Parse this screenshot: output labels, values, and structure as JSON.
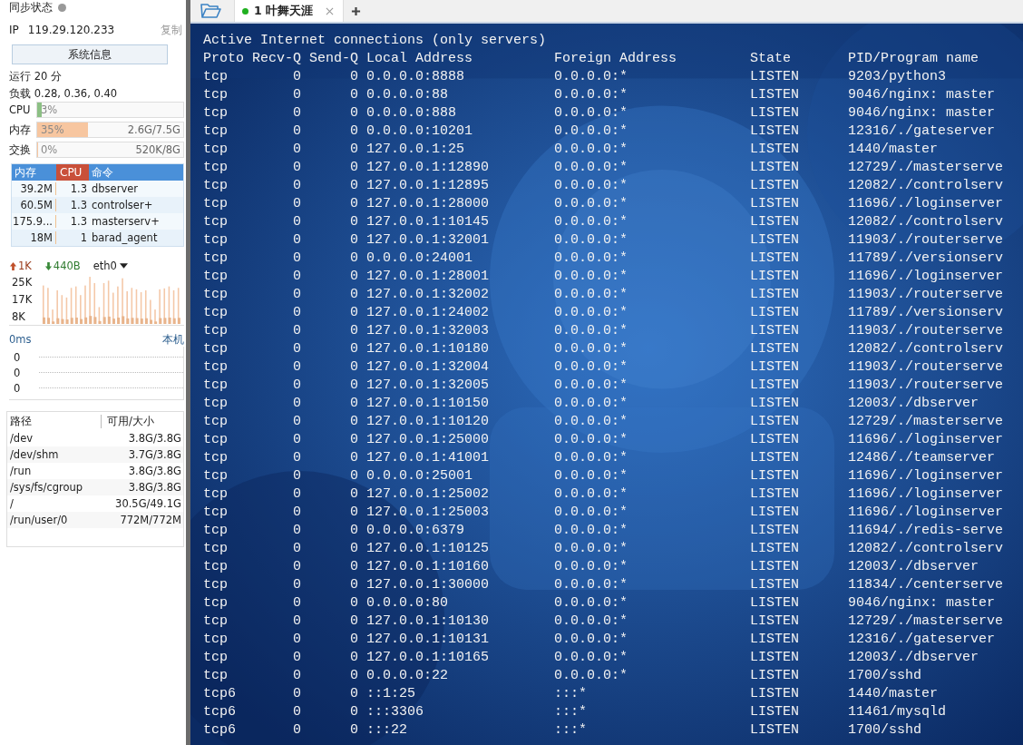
{
  "sidebar": {
    "sync_label": "同步状态",
    "sync_online": false,
    "ip_label": "IP",
    "ip": "119.29.120.233",
    "copy_link": "复制",
    "sysinfo_button": "系统信息",
    "uptime": "运行 20 分",
    "load": "负载 0.28, 0.36, 0.40",
    "meters": [
      {
        "label": "CPU",
        "value": "3%",
        "level": 0.03,
        "color": "#8cc084"
      },
      {
        "label": "内存",
        "value": "35%",
        "level": 0.35,
        "reading": "2.6G/7.5G",
        "color": "#f7c6a0"
      },
      {
        "label": "交换",
        "value": "0%",
        "level": 0,
        "reading": "520K/8G",
        "color": "#f7c6a0"
      }
    ],
    "processes": {
      "columns": [
        {
          "label": "内存",
          "selected": false
        },
        {
          "label": "CPU",
          "selected": true
        },
        {
          "label": "命令",
          "selected": false
        }
      ],
      "rows": [
        [
          "39.2M",
          "1.3",
          "dbserver"
        ],
        [
          "60.5M",
          "1.3",
          "controlser+"
        ],
        [
          "175.9...",
          "1.3",
          "masterserv+"
        ],
        [
          "18M",
          "1",
          "barad_agent"
        ]
      ]
    },
    "network": {
      "up": "1K",
      "down": "440B",
      "interface": "eth0",
      "yticks": [
        "25K",
        "17K",
        "8K"
      ]
    },
    "ping": {
      "latency": "0ms",
      "host": "本机",
      "values": [
        "0",
        "0",
        "0"
      ]
    },
    "disks": {
      "columns": [
        "路径",
        "可用/大小"
      ],
      "rows": [
        {
          "path": "/dev",
          "usage": "3.8G/3.8G"
        },
        {
          "path": "/dev/shm",
          "usage": "3.7G/3.8G"
        },
        {
          "path": "/run",
          "usage": "3.8G/3.8G"
        },
        {
          "path": "/sys/fs/cgroup",
          "usage": "3.8G/3.8G"
        },
        {
          "path": "/",
          "usage": "30.5G/49.1G"
        },
        {
          "path": "/run/user/0",
          "usage": "772M/772M"
        }
      ]
    }
  },
  "tabs": [
    {
      "label": "1 叶舞天涯",
      "selected": true,
      "connected": true
    }
  ],
  "terminal": {
    "title_line": "Active Internet connections (only servers)",
    "columns": [
      "Proto",
      "Recv-Q",
      "Send-Q",
      "Local Address",
      "Foreign Address",
      "State",
      "PID/Program name"
    ],
    "rows": [
      [
        "tcp",
        "0",
        "0",
        "0.0.0.0:8888",
        "0.0.0.0:*",
        "LISTEN",
        "9203/python3"
      ],
      [
        "tcp",
        "0",
        "0",
        "0.0.0.0:88",
        "0.0.0.0:*",
        "LISTEN",
        "9046/nginx: master"
      ],
      [
        "tcp",
        "0",
        "0",
        "0.0.0.0:888",
        "0.0.0.0:*",
        "LISTEN",
        "9046/nginx: master"
      ],
      [
        "tcp",
        "0",
        "0",
        "0.0.0.0:10201",
        "0.0.0.0:*",
        "LISTEN",
        "12316/./gateserver"
      ],
      [
        "tcp",
        "0",
        "0",
        "127.0.0.1:25",
        "0.0.0.0:*",
        "LISTEN",
        "1440/master"
      ],
      [
        "tcp",
        "0",
        "0",
        "127.0.0.1:12890",
        "0.0.0.0:*",
        "LISTEN",
        "12729/./masterserve"
      ],
      [
        "tcp",
        "0",
        "0",
        "127.0.0.1:12895",
        "0.0.0.0:*",
        "LISTEN",
        "12082/./controlserv"
      ],
      [
        "tcp",
        "0",
        "0",
        "127.0.0.1:28000",
        "0.0.0.0:*",
        "LISTEN",
        "11696/./loginserver"
      ],
      [
        "tcp",
        "0",
        "0",
        "127.0.0.1:10145",
        "0.0.0.0:*",
        "LISTEN",
        "12082/./controlserv"
      ],
      [
        "tcp",
        "0",
        "0",
        "127.0.0.1:32001",
        "0.0.0.0:*",
        "LISTEN",
        "11903/./routerserve"
      ],
      [
        "tcp",
        "0",
        "0",
        "0.0.0.0:24001",
        "0.0.0.0:*",
        "LISTEN",
        "11789/./versionserv"
      ],
      [
        "tcp",
        "0",
        "0",
        "127.0.0.1:28001",
        "0.0.0.0:*",
        "LISTEN",
        "11696/./loginserver"
      ],
      [
        "tcp",
        "0",
        "0",
        "127.0.0.1:32002",
        "0.0.0.0:*",
        "LISTEN",
        "11903/./routerserve"
      ],
      [
        "tcp",
        "0",
        "0",
        "127.0.0.1:24002",
        "0.0.0.0:*",
        "LISTEN",
        "11789/./versionserv"
      ],
      [
        "tcp",
        "0",
        "0",
        "127.0.0.1:32003",
        "0.0.0.0:*",
        "LISTEN",
        "11903/./routerserve"
      ],
      [
        "tcp",
        "0",
        "0",
        "127.0.0.1:10180",
        "0.0.0.0:*",
        "LISTEN",
        "12082/./controlserv"
      ],
      [
        "tcp",
        "0",
        "0",
        "127.0.0.1:32004",
        "0.0.0.0:*",
        "LISTEN",
        "11903/./routerserve"
      ],
      [
        "tcp",
        "0",
        "0",
        "127.0.0.1:32005",
        "0.0.0.0:*",
        "LISTEN",
        "11903/./routerserve"
      ],
      [
        "tcp",
        "0",
        "0",
        "127.0.0.1:10150",
        "0.0.0.0:*",
        "LISTEN",
        "12003/./dbserver"
      ],
      [
        "tcp",
        "0",
        "0",
        "127.0.0.1:10120",
        "0.0.0.0:*",
        "LISTEN",
        "12729/./masterserve"
      ],
      [
        "tcp",
        "0",
        "0",
        "127.0.0.1:25000",
        "0.0.0.0:*",
        "LISTEN",
        "11696/./loginserver"
      ],
      [
        "tcp",
        "0",
        "0",
        "127.0.0.1:41001",
        "0.0.0.0:*",
        "LISTEN",
        "12486/./teamserver"
      ],
      [
        "tcp",
        "0",
        "0",
        "0.0.0.0:25001",
        "0.0.0.0:*",
        "LISTEN",
        "11696/./loginserver"
      ],
      [
        "tcp",
        "0",
        "0",
        "127.0.0.1:25002",
        "0.0.0.0:*",
        "LISTEN",
        "11696/./loginserver"
      ],
      [
        "tcp",
        "0",
        "0",
        "127.0.0.1:25003",
        "0.0.0.0:*",
        "LISTEN",
        "11696/./loginserver"
      ],
      [
        "tcp",
        "0",
        "0",
        "0.0.0.0:6379",
        "0.0.0.0:*",
        "LISTEN",
        "11694/./redis-serve"
      ],
      [
        "tcp",
        "0",
        "0",
        "127.0.0.1:10125",
        "0.0.0.0:*",
        "LISTEN",
        "12082/./controlserv"
      ],
      [
        "tcp",
        "0",
        "0",
        "127.0.0.1:10160",
        "0.0.0.0:*",
        "LISTEN",
        "12003/./dbserver"
      ],
      [
        "tcp",
        "0",
        "0",
        "127.0.0.1:30000",
        "0.0.0.0:*",
        "LISTEN",
        "11834/./centerserve"
      ],
      [
        "tcp",
        "0",
        "0",
        "0.0.0.0:80",
        "0.0.0.0:*",
        "LISTEN",
        "9046/nginx: master"
      ],
      [
        "tcp",
        "0",
        "0",
        "127.0.0.1:10130",
        "0.0.0.0:*",
        "LISTEN",
        "12729/./masterserve"
      ],
      [
        "tcp",
        "0",
        "0",
        "127.0.0.1:10131",
        "0.0.0.0:*",
        "LISTEN",
        "12316/./gateserver"
      ],
      [
        "tcp",
        "0",
        "0",
        "127.0.0.1:10165",
        "0.0.0.0:*",
        "LISTEN",
        "12003/./dbserver"
      ],
      [
        "tcp",
        "0",
        "0",
        "0.0.0.0:22",
        "0.0.0.0:*",
        "LISTEN",
        "1700/sshd"
      ],
      [
        "tcp6",
        "0",
        "0",
        "::1:25",
        ":::*",
        "LISTEN",
        "1440/master"
      ],
      [
        "tcp6",
        "0",
        "0",
        ":::3306",
        ":::*",
        "LISTEN",
        "11461/mysqld"
      ],
      [
        "tcp6",
        "0",
        "0",
        ":::22",
        ":::*",
        "LISTEN",
        "1700/sshd"
      ]
    ]
  }
}
